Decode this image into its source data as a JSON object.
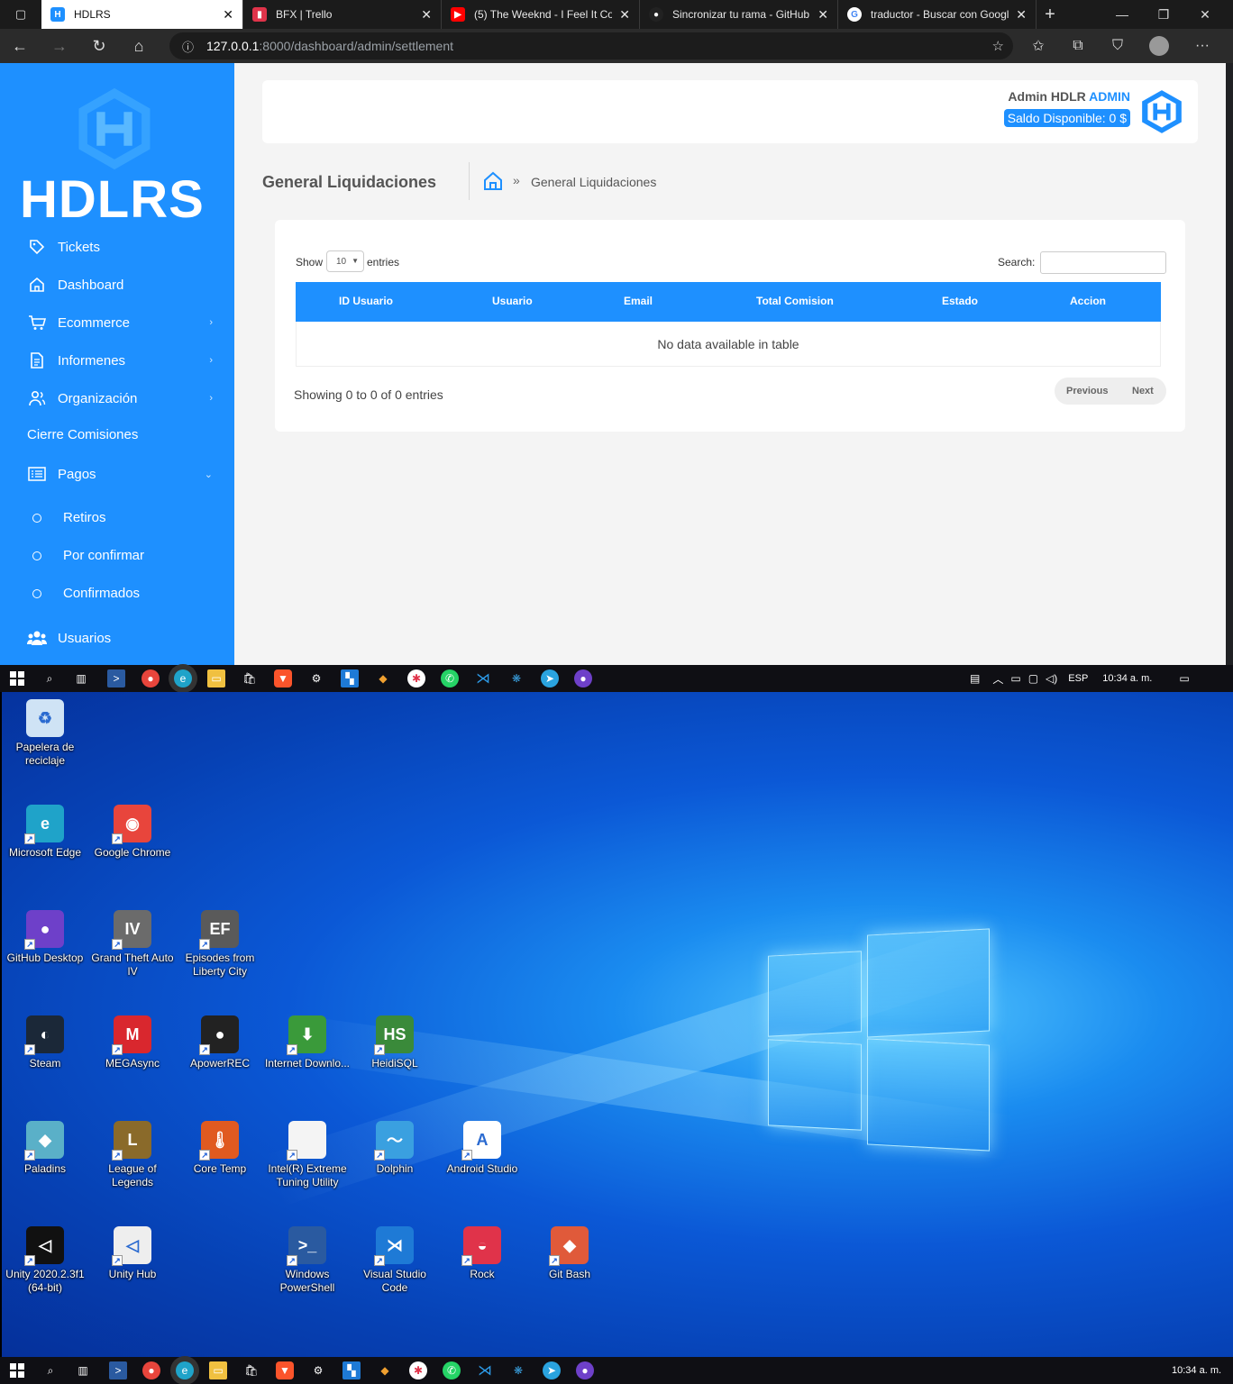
{
  "browser": {
    "tabs": [
      {
        "title": "HDLRS",
        "favicon": "hdlrs-icon",
        "active": true
      },
      {
        "title": "BFX | Trello",
        "favicon": "trello-icon",
        "active": false
      },
      {
        "title": "(5) The Weeknd - I Feel It Co",
        "favicon": "youtube-icon",
        "active": false
      },
      {
        "title": "Sincronizar tu rama - GitHub",
        "favicon": "github-icon",
        "active": false
      },
      {
        "title": "traductor - Buscar con Googl",
        "favicon": "google-icon",
        "active": false
      }
    ],
    "url_host": "127.0.0.1",
    "url_path": ":8000/dashboard/admin/settlement"
  },
  "sidebar": {
    "brand": "HDLRS",
    "items": [
      {
        "label": "Tickets",
        "icon": "tag-icon"
      },
      {
        "label": "Dashboard",
        "icon": "home-icon"
      },
      {
        "label": "Ecommerce",
        "icon": "cart-icon",
        "chevron": true
      },
      {
        "label": "Informenes",
        "icon": "document-icon",
        "chevron": true
      },
      {
        "label": "Organización",
        "icon": "users-icon",
        "chevron": true
      },
      {
        "label": "Cierre Comisiones"
      },
      {
        "label": "Pagos",
        "icon": "list-icon",
        "chevron": true,
        "expanded": true
      },
      {
        "label": "Usuarios",
        "icon": "group-icon"
      }
    ],
    "pagos_sub": [
      "Retiros",
      "Por confirmar",
      "Confirmados"
    ]
  },
  "header": {
    "admin_name": "Admin HDLR",
    "admin_role": "ADMIN",
    "balance": "Saldo Disponible: 0 $"
  },
  "page": {
    "title": "General Liquidaciones",
    "breadcrumb": "General Liquidaciones"
  },
  "table": {
    "show_label": "Show",
    "page_size": "10",
    "entries_label": "entries",
    "search_label": "Search:",
    "columns": [
      "ID Usuario",
      "Usuario",
      "Email",
      "Total Comision",
      "Estado",
      "Accion"
    ],
    "empty_message": "No data available in table",
    "info": "Showing 0 to 0 of 0 entries",
    "prev_label": "Previous",
    "next_label": "Next"
  },
  "taskbar": {
    "language": "ESP",
    "time": "10:34 a. m."
  },
  "desktop": {
    "icons": [
      {
        "label": "Papelera de reciclaje",
        "icon": "recycle-bin-icon",
        "color": "#cfe3f5"
      },
      {
        "label": "Microsoft Edge",
        "icon": "edge-icon",
        "color": "#1fa3c9"
      },
      {
        "label": "Google Chrome",
        "icon": "chrome-icon",
        "color": "#e8453c"
      },
      {
        "label": "GitHub Desktop",
        "icon": "github-desktop-icon",
        "color": "#6e40c9"
      },
      {
        "label": "Grand Theft Auto IV",
        "icon": "gta-iv-icon",
        "color": "#6b6b6b"
      },
      {
        "label": "Episodes from Liberty City",
        "icon": "gta-eflc-icon",
        "color": "#5a5a5a"
      },
      {
        "label": "Steam",
        "icon": "steam-icon",
        "color": "#1b2838"
      },
      {
        "label": "MEGAsync",
        "icon": "mega-icon",
        "color": "#d9272e"
      },
      {
        "label": "ApowerREC",
        "icon": "apowerrec-icon",
        "color": "#222222"
      },
      {
        "label": "Internet Downlo...",
        "icon": "idm-icon",
        "color": "#3a9a3a"
      },
      {
        "label": "HeidiSQL",
        "icon": "heidisql-icon",
        "color": "#3a8a3a"
      },
      {
        "label": "Paladins",
        "icon": "paladins-icon",
        "color": "#5ab0c8"
      },
      {
        "label": "League of Legends",
        "icon": "lol-icon",
        "color": "#8a6a2a"
      },
      {
        "label": "Core Temp",
        "icon": "coretemp-icon",
        "color": "#e05a20"
      },
      {
        "label": "Intel(R) Extreme Tuning Utility",
        "icon": "file-icon",
        "color": "#f4f4f4"
      },
      {
        "label": "Dolphin",
        "icon": "dolphin-icon",
        "color": "#3aa0e0"
      },
      {
        "label": "Android Studio",
        "icon": "android-studio-icon",
        "color": "#ffffff"
      },
      {
        "label": "Unity 2020.2.3f1 (64-bit)",
        "icon": "unity-icon",
        "color": "#111111"
      },
      {
        "label": "Unity Hub",
        "icon": "unity-hub-icon",
        "color": "#eeeeee"
      },
      {
        "label": "Windows PowerShell",
        "icon": "powershell-icon",
        "color": "#2a5aa0"
      },
      {
        "label": "Visual Studio Code",
        "icon": "vscode-icon",
        "color": "#1e7ad6"
      },
      {
        "label": "Rock",
        "icon": "rock-icon",
        "color": "#e0334a"
      },
      {
        "label": "Git Bash",
        "icon": "git-bash-icon",
        "color": "#e05a3a"
      }
    ]
  }
}
